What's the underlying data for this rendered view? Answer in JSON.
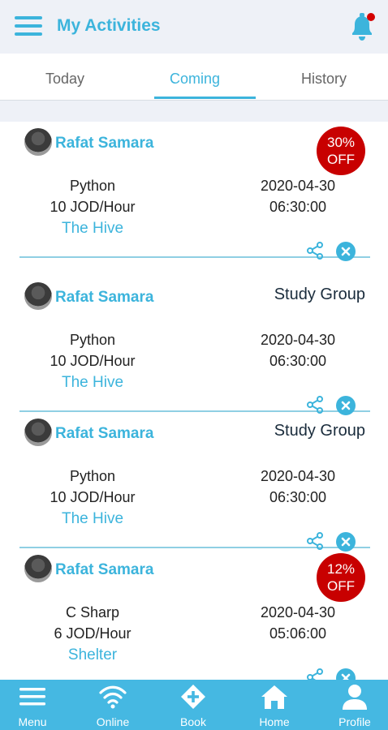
{
  "header": {
    "title": "My Activities"
  },
  "tabs": [
    {
      "label": "Today"
    },
    {
      "label": "Coming"
    },
    {
      "label": "History"
    }
  ],
  "activities": [
    {
      "name": "Rafat Samara",
      "badge_line1": "30%",
      "badge_line2": "OFF",
      "tag": "",
      "subject": "Python",
      "price": "10 JOD/Hour",
      "place": "The Hive",
      "date": "2020-04-30",
      "time": "06:30:00"
    },
    {
      "name": "Rafat Samara",
      "badge_line1": "",
      "badge_line2": "",
      "tag": "Study Group",
      "subject": "Python",
      "price": "10 JOD/Hour",
      "place": "The Hive",
      "date": "2020-04-30",
      "time": "06:30:00"
    },
    {
      "name": "Rafat Samara",
      "badge_line1": "",
      "badge_line2": "",
      "tag": "Study Group",
      "subject": "Python",
      "price": "10 JOD/Hour",
      "place": "The Hive",
      "date": "2020-04-30",
      "time": "06:30:00"
    },
    {
      "name": "Rafat Samara",
      "badge_line1": "12%",
      "badge_line2": "OFF",
      "tag": "",
      "subject": "C Sharp",
      "price": "6 JOD/Hour",
      "place": "Shelter",
      "date": "2020-04-30",
      "time": "05:06:00"
    }
  ],
  "bottom_nav": [
    {
      "label": "Menu",
      "icon": "menu-icon"
    },
    {
      "label": "Online",
      "icon": "wifi-icon"
    },
    {
      "label": "Book",
      "icon": "book-diamond-icon"
    },
    {
      "label": "Home",
      "icon": "home-icon"
    },
    {
      "label": "Profile",
      "icon": "profile-icon"
    }
  ],
  "colors": {
    "accent": "#3cb4dc",
    "nav_bg": "#45b8e2",
    "badge": "#c80000",
    "notification_dot": "#d40000"
  }
}
